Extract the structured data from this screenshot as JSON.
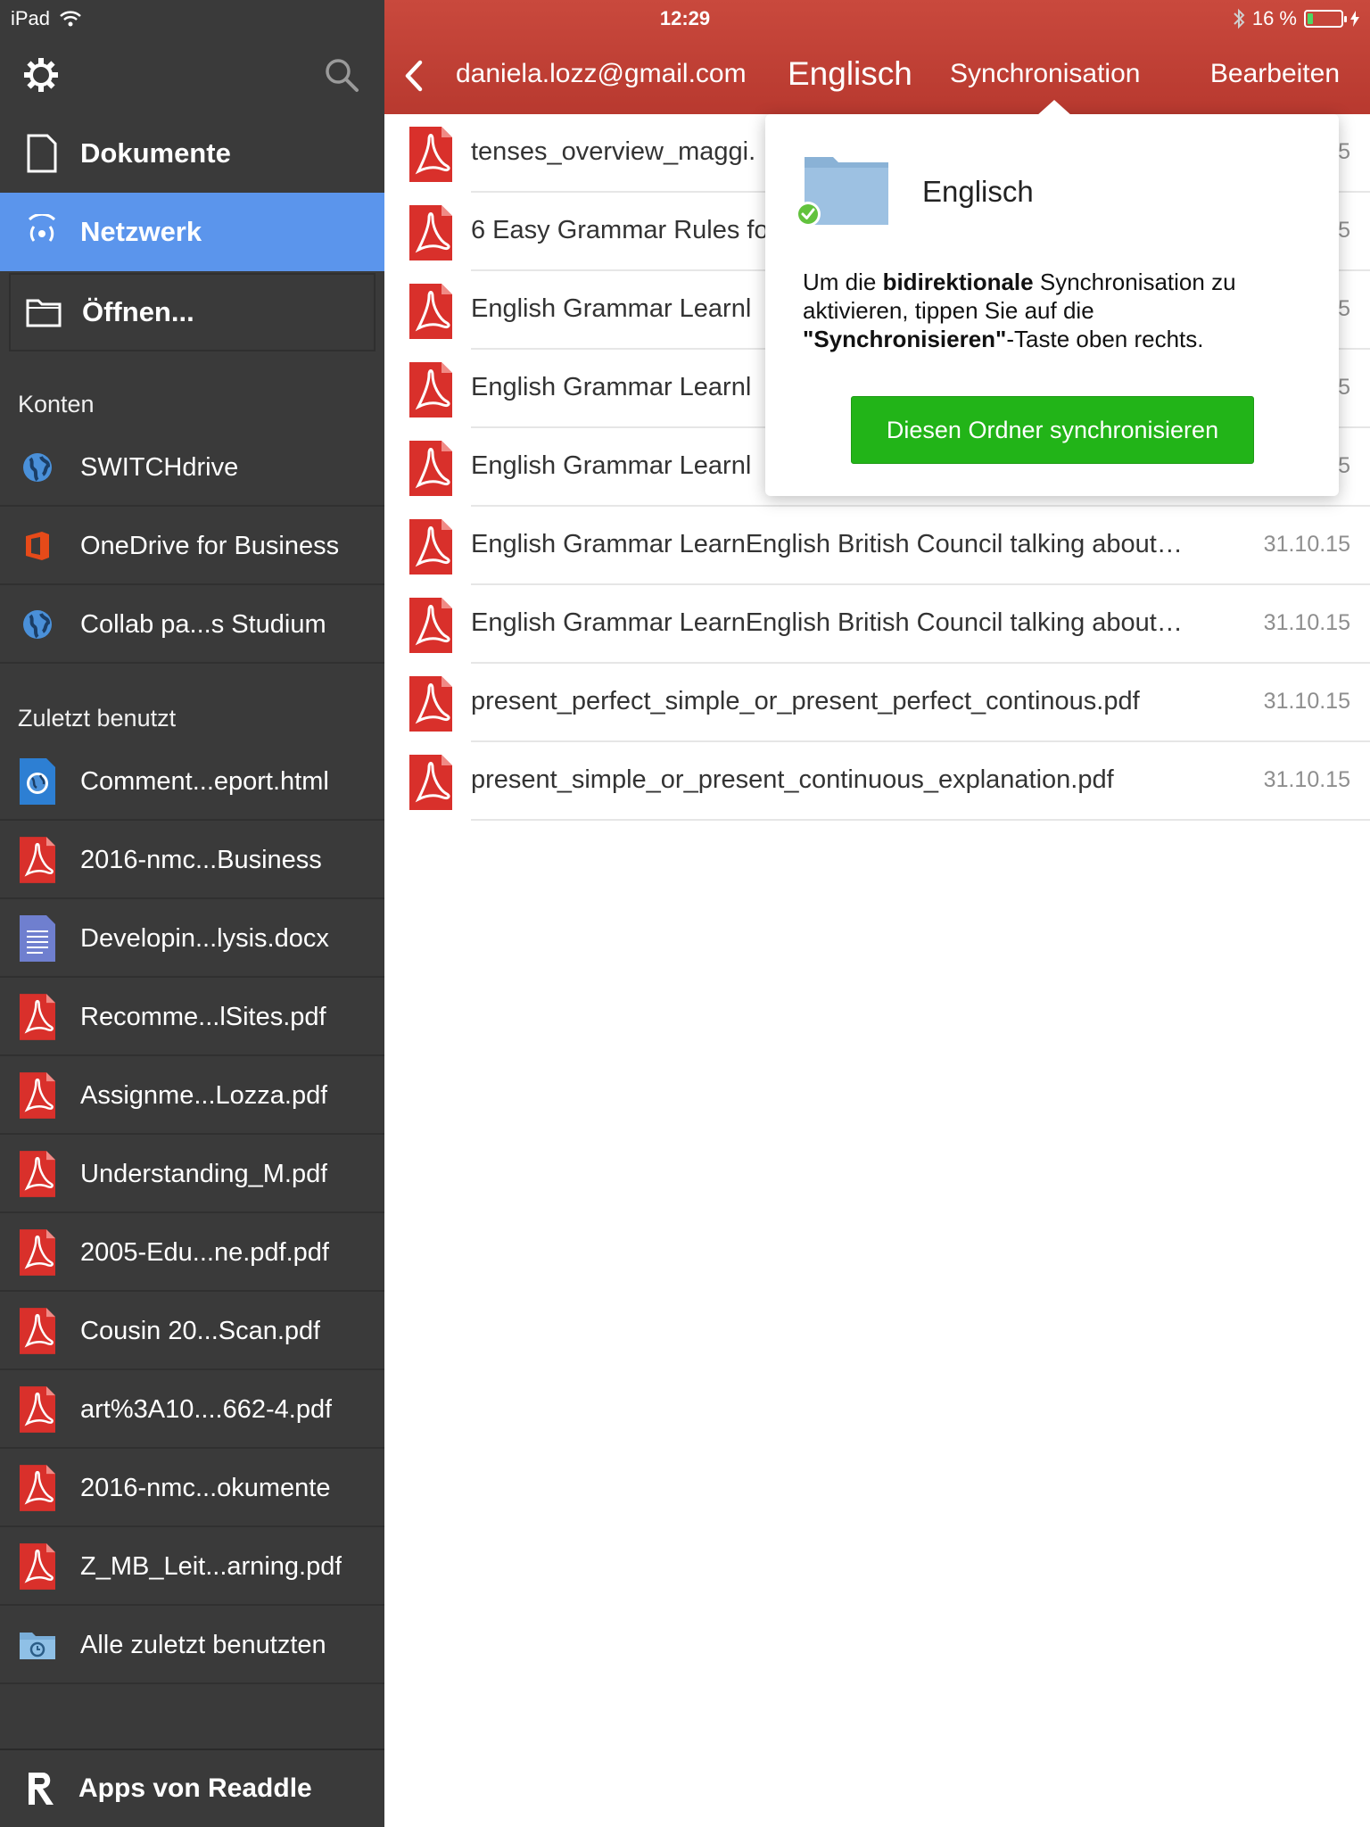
{
  "status": {
    "device": "iPad",
    "time": "12:29",
    "battery": "16 %",
    "battery_level": 0.16
  },
  "sidebar": {
    "nav": [
      {
        "label": "Dokumente",
        "icon": "document-icon"
      },
      {
        "label": "Netzwerk",
        "icon": "network-icon"
      },
      {
        "label": "Öffnen...",
        "icon": "folder-open-icon"
      }
    ],
    "accounts_label": "Konten",
    "accounts": [
      {
        "label": "SWITCHdrive",
        "icon": "globe-icon"
      },
      {
        "label": "OneDrive for Business",
        "icon": "office-icon"
      },
      {
        "label": "Collab pa...s Studium",
        "icon": "globe-icon"
      }
    ],
    "recent_label": "Zuletzt benutzt",
    "recent": [
      {
        "label": "Comment...eport.html",
        "icon": "html-file-icon"
      },
      {
        "label": "2016-nmc...Business",
        "icon": "pdf-icon"
      },
      {
        "label": "Developin...lysis.docx",
        "icon": "docx-icon"
      },
      {
        "label": "Recomme...lSites.pdf",
        "icon": "pdf-icon"
      },
      {
        "label": "Assignme...Lozza.pdf",
        "icon": "pdf-icon"
      },
      {
        "label": "Understanding_M.pdf",
        "icon": "pdf-icon"
      },
      {
        "label": "2005-Edu...ne.pdf.pdf",
        "icon": "pdf-icon"
      },
      {
        "label": "Cousin 20...Scan.pdf",
        "icon": "pdf-icon"
      },
      {
        "label": "art%3A10....662-4.pdf",
        "icon": "pdf-icon"
      },
      {
        "label": "2016-nmc...okumente",
        "icon": "pdf-icon"
      },
      {
        "label": "Z_MB_Leit...arning.pdf",
        "icon": "pdf-icon"
      },
      {
        "label": "Alle zuletzt benutzten",
        "icon": "recent-folder-icon"
      }
    ],
    "footer": "Apps von Readdle"
  },
  "header": {
    "account": "daniela.lozz@gmail.com",
    "folder": "Englisch",
    "sync": "Synchronisation",
    "edit": "Bearbeiten"
  },
  "files": [
    {
      "name": "tenses_overview_maggi.",
      "date": "5"
    },
    {
      "name": "6 Easy Grammar Rules fo",
      "date": "5"
    },
    {
      "name": "English Grammar  Learnl",
      "date": "5"
    },
    {
      "name": "English Grammar  Learnl",
      "date": "5"
    },
    {
      "name": "English Grammar  Learnl",
      "date": "5"
    },
    {
      "name": "English Grammar  LearnEnglish  British Council  talking about…",
      "date": "31.10.15"
    },
    {
      "name": "English Grammar  LearnEnglish  British Council  talking about…",
      "date": "31.10.15"
    },
    {
      "name": "present_perfect_simple_or_present_perfect_continous.pdf",
      "date": "31.10.15"
    },
    {
      "name": "present_simple_or_present_continuous_explanation.pdf",
      "date": "31.10.15"
    }
  ],
  "popover": {
    "title": "Englisch",
    "msg_1": "Um die ",
    "msg_bold_1": "bidirektionale",
    "msg_2": " Synchronisation zu aktivieren, tippen Sie auf die ",
    "msg_bold_2": "\"Synchronisieren\"",
    "msg_3": "-Taste oben rechts.",
    "button": "Diesen Ordner synchronisieren"
  },
  "colors": {
    "header": "#c5463c",
    "sidebar": "#3a3a3a",
    "active": "#5b95ec",
    "sync_button": "#22b418"
  }
}
